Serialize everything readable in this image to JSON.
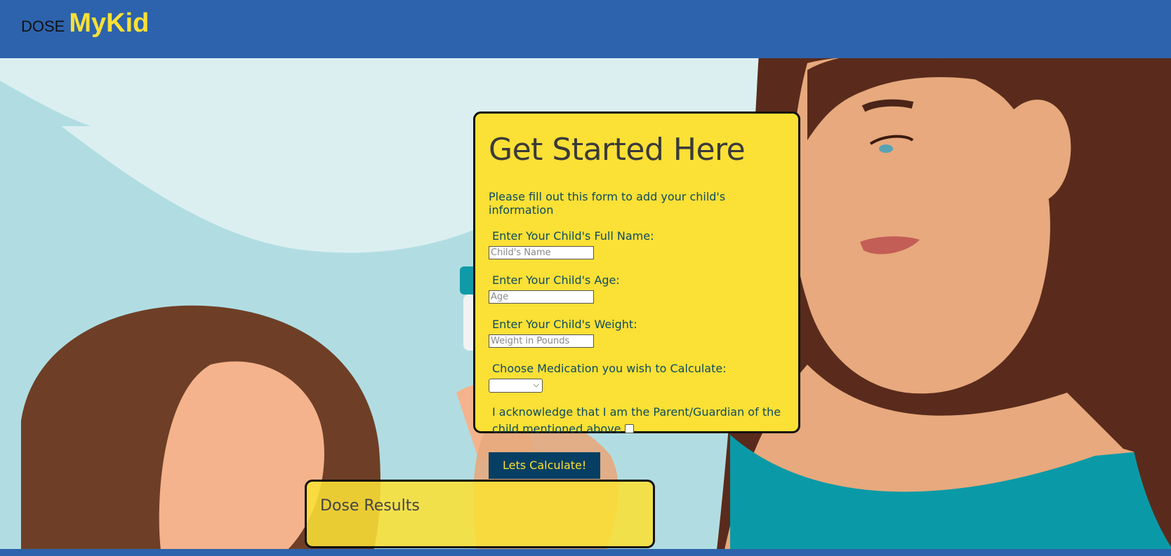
{
  "header": {
    "logo_small": "DOSE",
    "logo_big": "MyKid",
    "background_color": "#2d63ad",
    "accent_color": "#fbe035"
  },
  "form": {
    "title": "Get Started Here",
    "intro": "Please fill out this form to add your child's information",
    "name_label": "Enter Your Child's Full Name:",
    "name_placeholder": "Child's Name",
    "age_label": "Enter Your Child's Age:",
    "age_placeholder": "Age",
    "weight_label": "Enter Your Child's Weight:",
    "weight_placeholder": "Weight in Pounds",
    "medication_label": "Choose Medication you wish to Calculate:",
    "medication_selected": "",
    "acknowledge_text": "I acknowledge that I am the Parent/Guardian of the child mentioned above",
    "acknowledge_checked": false,
    "submit_label": "Lets Calculate!",
    "card_color": "#fbe035",
    "button_color": "#063f63"
  },
  "results": {
    "title": "Dose Results"
  }
}
